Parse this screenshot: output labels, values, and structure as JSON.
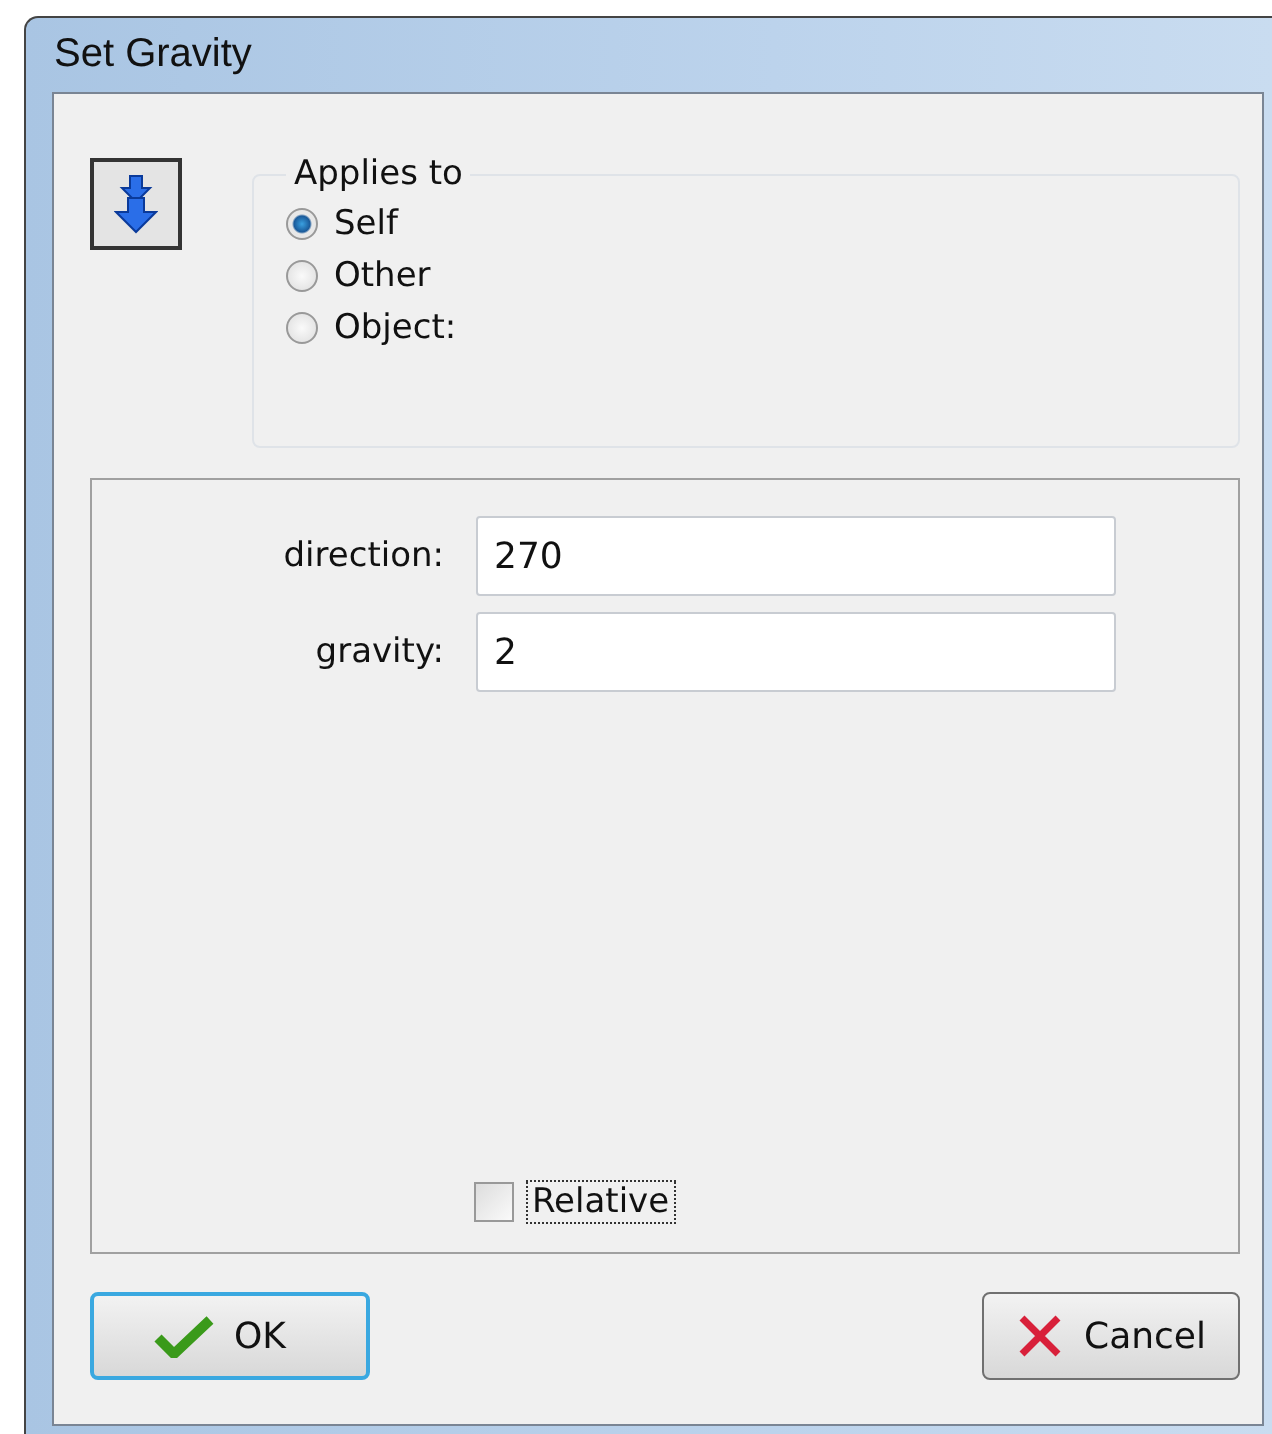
{
  "window": {
    "title": "Set Gravity"
  },
  "applies_to": {
    "label": "Applies to",
    "options": [
      {
        "label": "Self",
        "selected": true
      },
      {
        "label": "Other",
        "selected": false
      },
      {
        "label": "Object:",
        "selected": false
      }
    ]
  },
  "fields": [
    {
      "label": "direction:",
      "value": "270"
    },
    {
      "label": "gravity:",
      "value": "2"
    }
  ],
  "relative": {
    "label": "Relative",
    "checked": false
  },
  "buttons": {
    "ok": "OK",
    "cancel": "Cancel"
  }
}
